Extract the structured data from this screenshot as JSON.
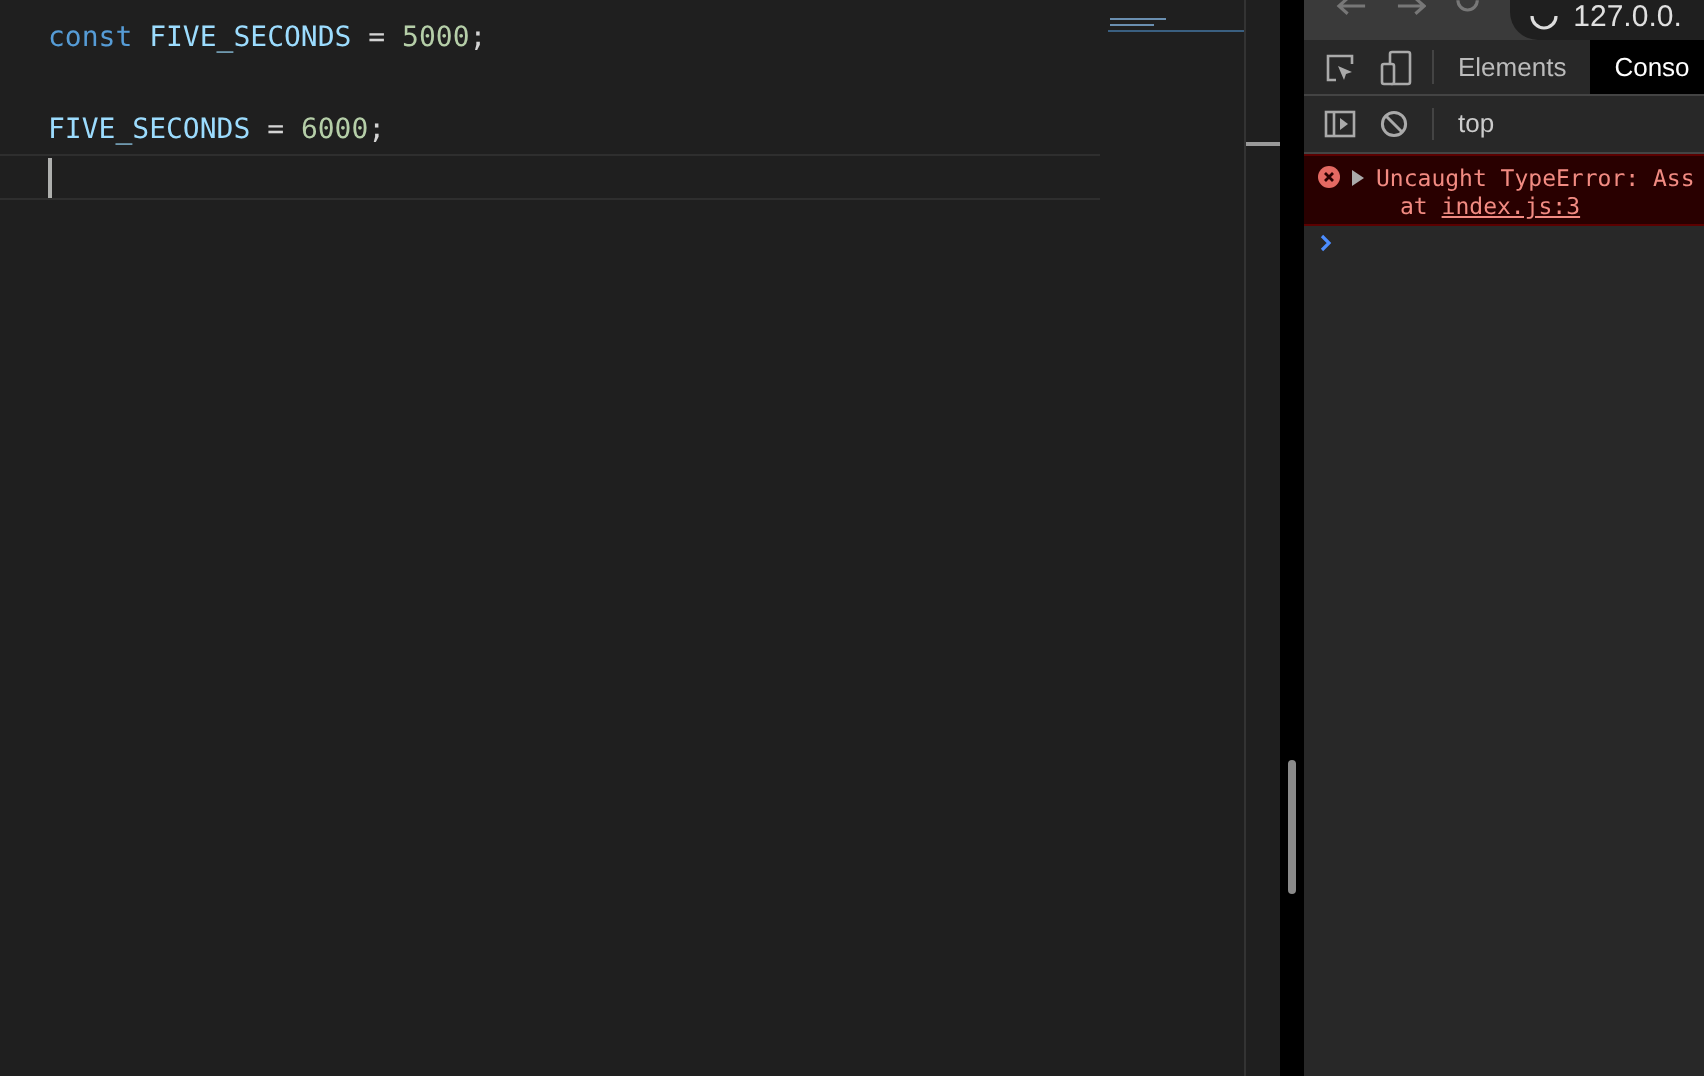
{
  "editor": {
    "lines": [
      {
        "kind": "code",
        "tokens": [
          {
            "kind": "keyword",
            "text": "const "
          },
          {
            "kind": "constant",
            "text": "FIVE_SECONDS"
          },
          {
            "kind": "plain",
            "text": " = "
          },
          {
            "kind": "number",
            "text": "5000"
          },
          {
            "kind": "plain",
            "text": ";"
          }
        ]
      },
      {
        "kind": "blank"
      },
      {
        "kind": "code",
        "tokens": [
          {
            "kind": "constant",
            "text": "FIVE_SECONDS"
          },
          {
            "kind": "plain",
            "text": " = "
          },
          {
            "kind": "number",
            "text": "6000"
          },
          {
            "kind": "plain",
            "text": ";"
          }
        ]
      },
      {
        "kind": "cursor"
      }
    ]
  },
  "browser": {
    "address": "127.0.0."
  },
  "devtools": {
    "tabs": [
      {
        "label": "Elements",
        "selected": false
      },
      {
        "label": "Conso",
        "selected": true
      }
    ],
    "context": "top",
    "messages": [
      {
        "kind": "error",
        "text": "Uncaught TypeError: Ass",
        "prefix": "at",
        "source": "index.js:3"
      }
    ]
  }
}
